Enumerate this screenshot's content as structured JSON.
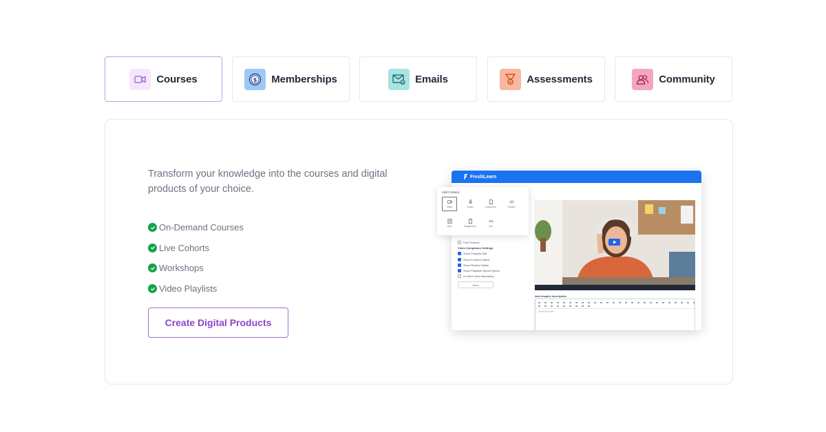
{
  "tabs": [
    {
      "label": "Courses",
      "icon": "video-camera-icon",
      "bg": "#f3e8fb",
      "active": true
    },
    {
      "label": "Memberships",
      "icon": "dollar-coin-icon",
      "bg": "#9ec8f5",
      "active": false
    },
    {
      "label": "Emails",
      "icon": "mail-icon",
      "bg": "#a8e4e4",
      "active": false
    },
    {
      "label": "Assessments",
      "icon": "trophy-icon",
      "bg": "#f9b6a0",
      "active": false
    },
    {
      "label": "Community",
      "icon": "people-icon",
      "bg": "#f3a5c2",
      "active": false
    }
  ],
  "panel": {
    "intro": "Transform your knowledge into the courses and digital products of your choice.",
    "features": [
      "On-Demand Courses",
      "Live Cohorts",
      "Workshops",
      "Video Playlists"
    ],
    "cta_label": "Create Digital Products"
  },
  "preview": {
    "brand": "FreshLearn",
    "popup_title": "Add Content",
    "options": [
      "Video",
      "Audio",
      "Document",
      "Embed",
      "Quiz",
      "Assignment",
      "Live"
    ],
    "free_preview": "Free Preview",
    "settings_title": "Video Compliance Settings",
    "settings": [
      "Show Progress Bar",
      "Show Forward Option",
      "Show Rewind Option",
      "Show Playback Speed Option",
      "In-Video View Mandatory"
    ],
    "save_label": "Save",
    "description_title": "Add chapter description",
    "editor_placeholder": "Insert text here..."
  },
  "colors": {
    "accent_purple": "#8b44c9",
    "check_green": "#16a34a",
    "brand_blue": "#1a73f0"
  }
}
